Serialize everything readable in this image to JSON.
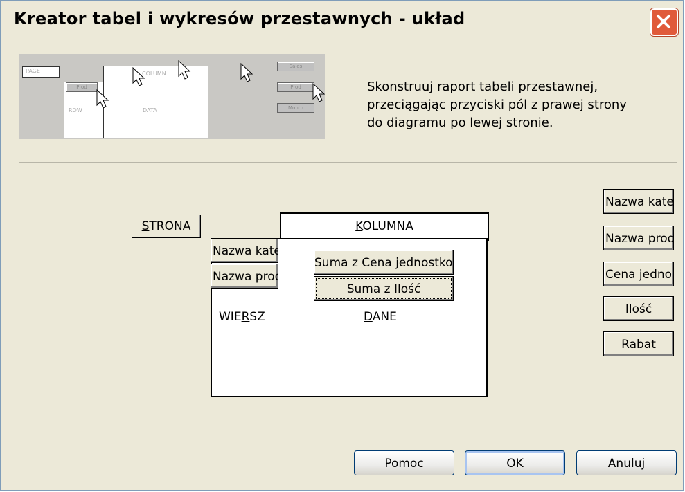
{
  "window": {
    "title": "Kreator tabel i wykresów przestawnych - układ"
  },
  "preview": {
    "labels": {
      "page": "PAGE",
      "column": "COLUMN",
      "row": "ROW",
      "data": "DATA",
      "row_field": "Prod"
    },
    "buttons": [
      "Sales",
      "Prod",
      "Month"
    ]
  },
  "instructions": "Skonstruuj raport tabeli przestawnej, przeciągając przyciski pól z prawej strony do diagramu po lewej stronie.",
  "layout": {
    "page_area": {
      "pre": "",
      "access": "S",
      "post": "TRONA"
    },
    "column_area": {
      "pre": "",
      "access": "K",
      "post": "OLUMNA"
    },
    "row_area": {
      "pre": "WIE",
      "access": "R",
      "post": "SZ"
    },
    "data_area": {
      "pre": "",
      "access": "D",
      "post": "ANE"
    },
    "row_fields": [
      "Nazwa kategorii",
      "Nazwa produktu"
    ],
    "data_fields": [
      "Suma z Cena jednostkowa",
      "Suma z Ilość"
    ]
  },
  "field_list": [
    "Nazwa kategorii",
    "Nazwa produktu",
    "Cena jednostkowa",
    "Ilość",
    "Rabat"
  ],
  "buttons": {
    "help": {
      "pre": "Pomo",
      "access": "c",
      "post": ""
    },
    "ok": "OK",
    "cancel": "Anuluj"
  }
}
